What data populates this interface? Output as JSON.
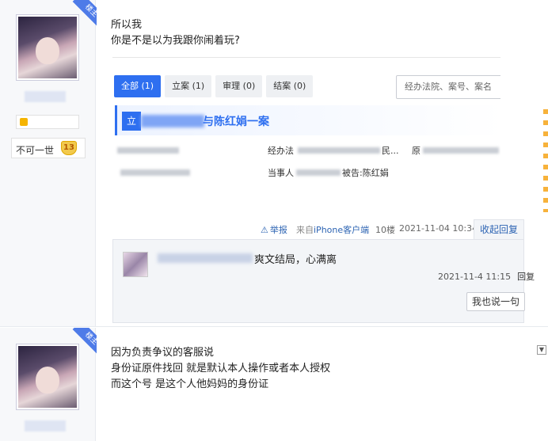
{
  "badges": {
    "louzhu": "楼主"
  },
  "post1": {
    "user_title": "不可一世",
    "user_level": "13",
    "text_lines": [
      "所以我",
      "你是不是以为我跟你闹着玩?"
    ],
    "embed": {
      "tabs": [
        "全部 (1)",
        "立案 (1)",
        "审理 (0)",
        "结案 (0)"
      ],
      "search_placeholder": "经办法院、案号、案名",
      "case_prefix": "立",
      "case_title": "与陈红娟一案",
      "row1_label": "经办法",
      "row1_suffix": "民...",
      "row1_tail": "原",
      "row2_label": "当事人",
      "row2_suffix": "被告:陈红娟"
    },
    "meta": {
      "report": "举报",
      "source_prefix": "来自",
      "source_link": "iPhone客户端",
      "floor": "10楼",
      "time": "2021-11-04 10:34",
      "collapse_reply": "收起回复"
    },
    "subreply": {
      "text": "爽文结局，心满离",
      "time": "2021-11-4 11:15",
      "reply": "回复",
      "say_button": "我也说一句"
    }
  },
  "post2": {
    "text_lines": [
      "因为负责争议的客服说",
      "身份证原件找回 就是默认本人操作或者本人授权",
      "而这个号 是这个人他妈妈的身份证"
    ],
    "collapse_icon": "▼"
  }
}
